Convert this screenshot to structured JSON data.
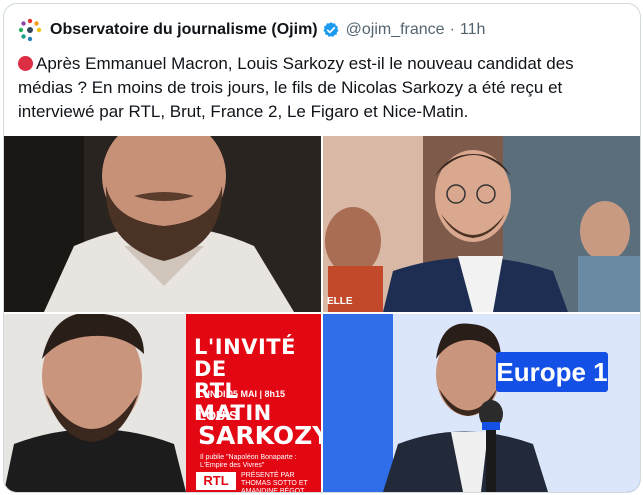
{
  "tweet": {
    "author_name": "Observatoire du journalisme (Ojim)",
    "handle": "@ojim_france",
    "separator": "·",
    "time": "11h",
    "avatar_icon": "ojim-logo-icon",
    "verified_icon": "verified-badge-icon",
    "text": "Après Emmanuel Macron, Louis Sarkozy est-il le nouveau candidat des médias ? En moins de trois jours, le fils de Nicolas Sarkozy a été reçu et interviewé par RTL, Brut, France 2, Le Figaro et Nice-Matin.",
    "status_icon": "red-circle-icon"
  },
  "media": {
    "rtl_card": {
      "title_line1": "L'INVITÉ DE",
      "title_line2": "RTL MATIN",
      "date": "LUNDI 05 MAI | 8h15",
      "name_first": "LOUIS",
      "name_last": "SARKOZY",
      "subtitle": "Il publie \"Napoléon Bonaparte : L'Empire des Vivres\"",
      "logo": "RTL",
      "credit": "PRÉSENTÉ PAR THOMAS SOTTO ET AMANDINE BÉGOT #RTLMATIN"
    },
    "europe1_logo": "Europe 1"
  },
  "colors": {
    "accent": "#1d9bf0",
    "rtl_red": "#e30613",
    "europe1_blue": "#1550e6"
  }
}
